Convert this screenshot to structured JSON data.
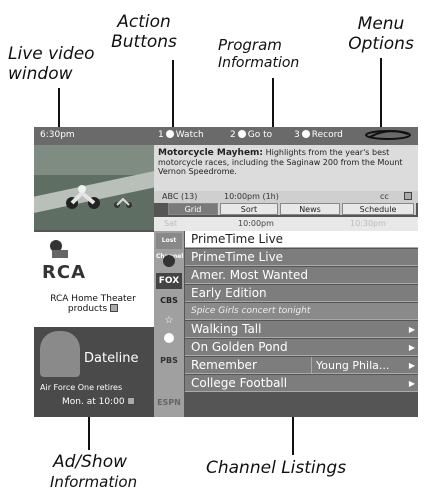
{
  "callouts": {
    "action_buttons": [
      "Action",
      "Buttons"
    ],
    "program_information": [
      "Program",
      "Information"
    ],
    "menu_options": [
      "Menu",
      "Options"
    ],
    "live_video": [
      "Live video",
      "window"
    ],
    "ad_show": [
      "Ad/Show",
      "Information"
    ],
    "channel_listings": "Channel Listings"
  },
  "topbar": {
    "clock": "6:30pm",
    "actions": [
      {
        "num": "1",
        "label": "Watch"
      },
      {
        "num": "2",
        "label": "Go to"
      },
      {
        "num": "3",
        "label": "Record"
      }
    ],
    "logo_icon": "brand-logo-icon"
  },
  "program": {
    "title": "Motorcycle Mayhem:",
    "description": " Highlights from the year's best motorcycle races, including the Saginaw 200 from the Mount Vernon Speedrome."
  },
  "meta": {
    "channel": "ABC (13)",
    "time": "10:00pm (1h)",
    "cc": "cc"
  },
  "menu": {
    "tabs": [
      "Grid",
      "Sort",
      "News",
      "Schedule"
    ],
    "active": "Grid"
  },
  "grid": {
    "day": "Sat",
    "slots": [
      "10:00pm",
      "10:30pm"
    ]
  },
  "ad": {
    "brand": "RCA",
    "text_line1": "RCA Home Theater",
    "text_line2": "products"
  },
  "show": {
    "title": "Dateline",
    "desc": "Air Force One retires",
    "time": "Mon. at 10:00"
  },
  "channels": [
    {
      "icon": "Lost Channel",
      "program": "PrimeTime Live",
      "sub": "",
      "selected": true
    },
    {
      "icon": "abc",
      "program": "PrimeTime Live",
      "sub": ""
    },
    {
      "icon": "FOX",
      "program": "Amer. Most Wanted",
      "sub": ""
    },
    {
      "icon": "CBS",
      "program": "Early Edition",
      "sub": ""
    },
    {
      "icon": "promo",
      "program": "Spice Girls concert tonight",
      "sub": "",
      "italic": true
    },
    {
      "icon": "rec",
      "program": "Walking Tall",
      "sub": ""
    },
    {
      "icon": "PBS",
      "program": "On Golden Pond",
      "sub": ""
    },
    {
      "icon": "",
      "program": "Remember",
      "sub": "Young Phila..."
    },
    {
      "icon": "ESPN",
      "program": "College Football",
      "sub": ""
    }
  ]
}
